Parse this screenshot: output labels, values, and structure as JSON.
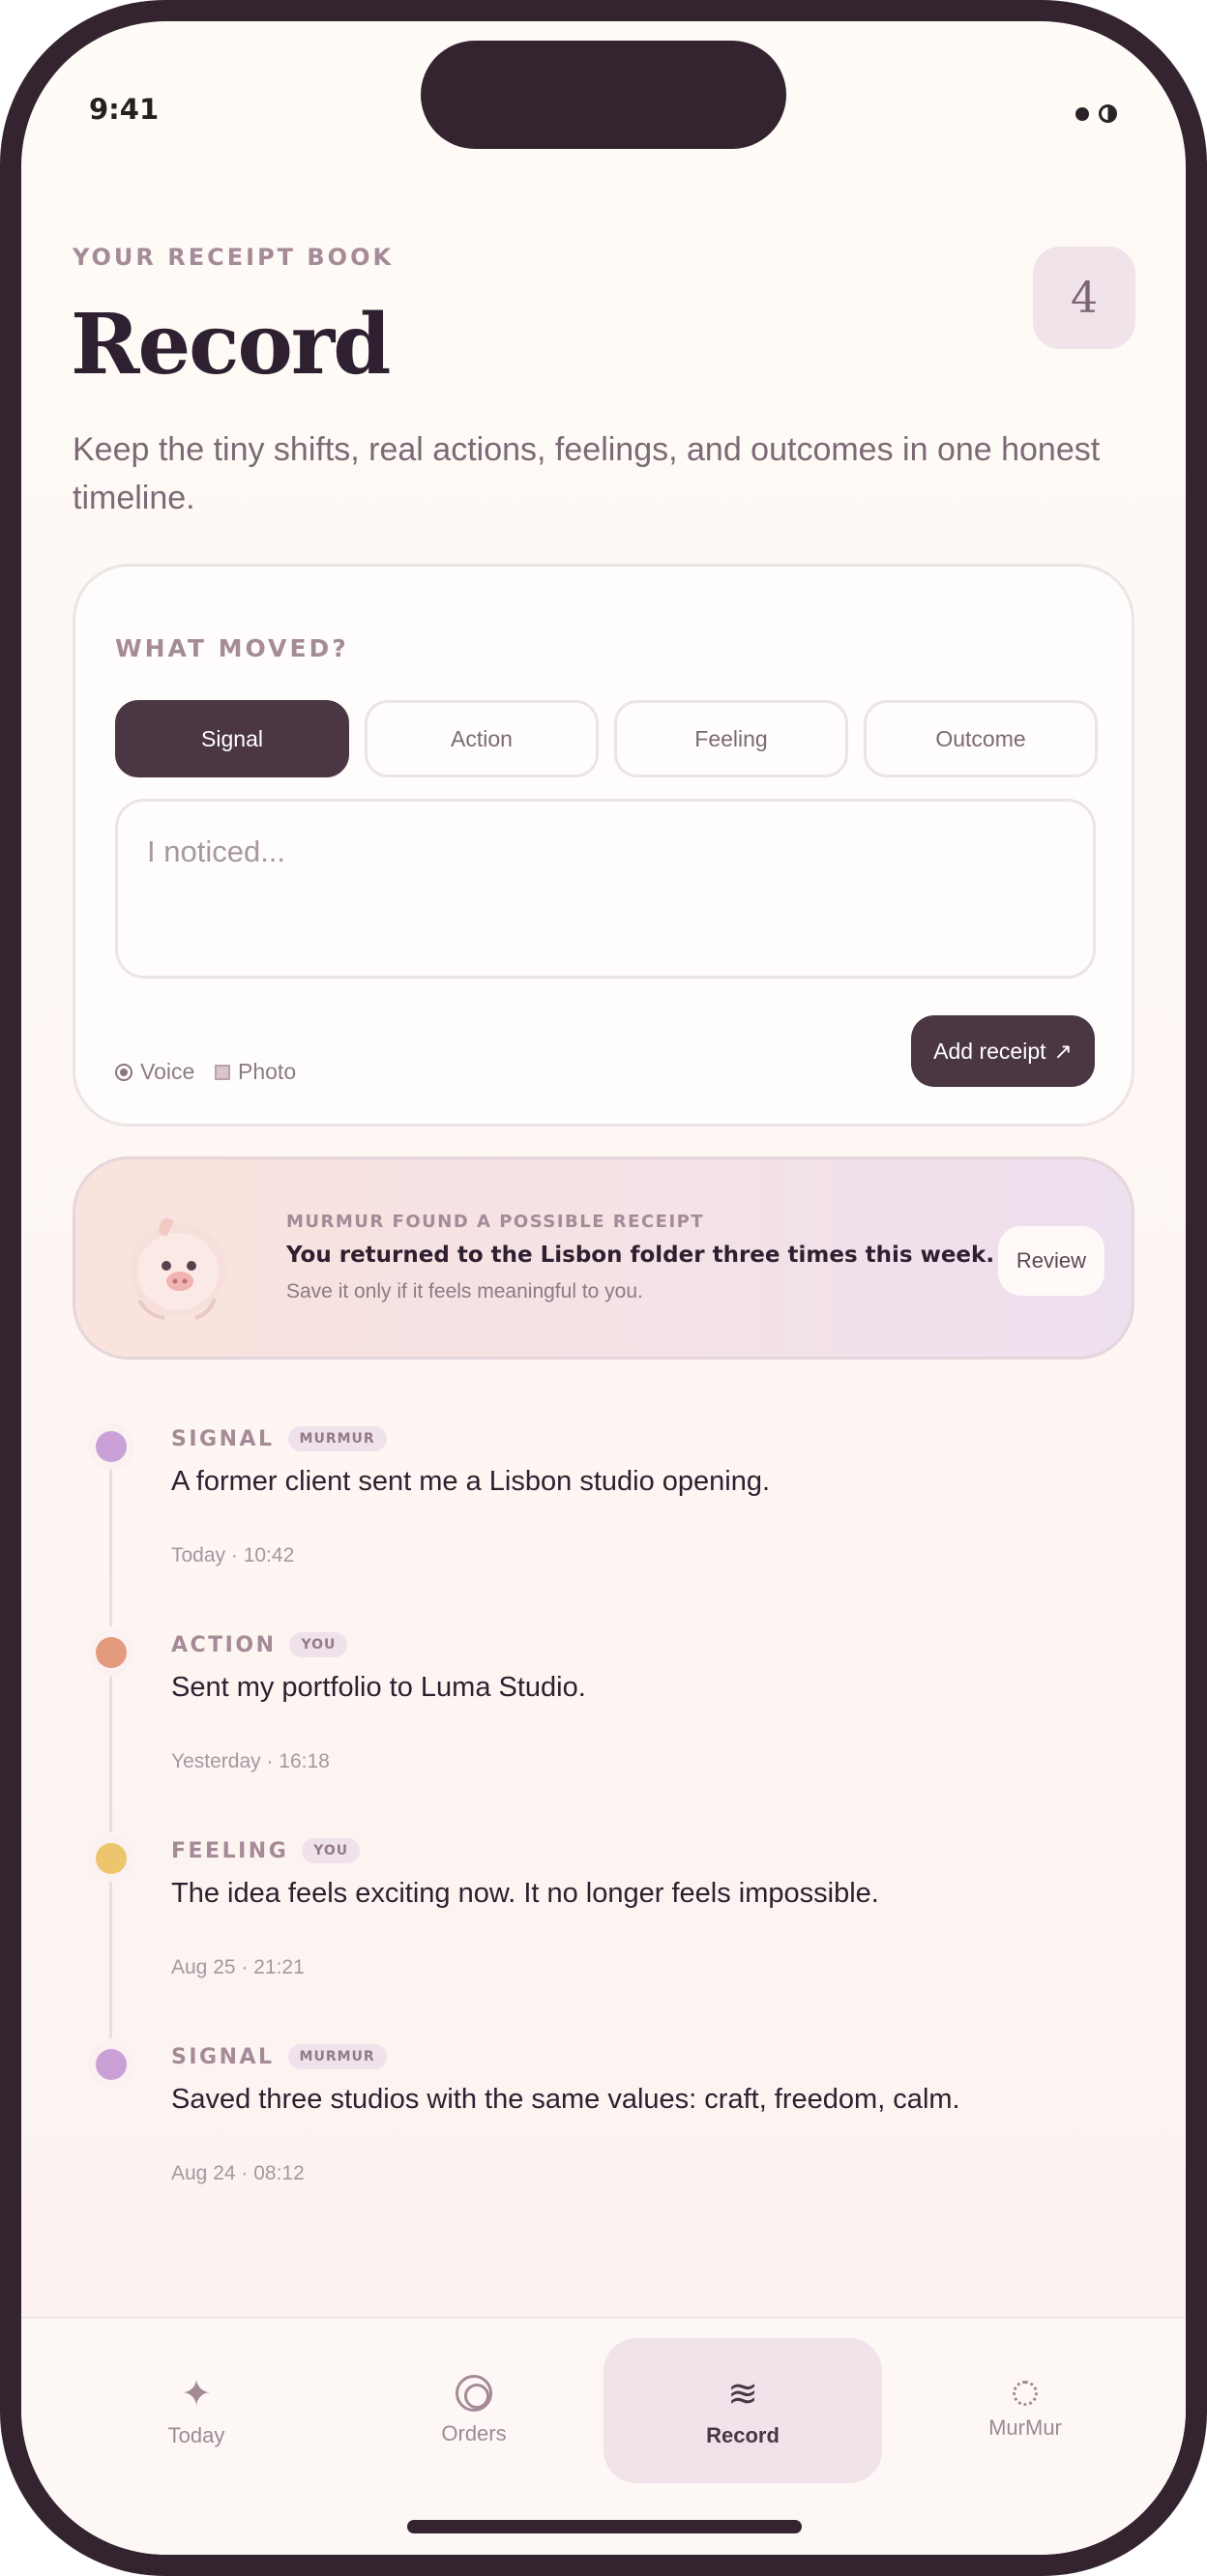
{
  "status_bar": {
    "time": "9:41",
    "icons": [
      "dot-icon",
      "half-circle-icon"
    ]
  },
  "header": {
    "eyebrow": "YOUR RECEIPT BOOK",
    "title": "Record",
    "count": "4",
    "subtitle": "Keep the tiny shifts, real actions, feelings, and outcomes in one honest timeline."
  },
  "compose": {
    "label": "WHAT MOVED?",
    "chips": [
      {
        "label": "Signal",
        "selected": true
      },
      {
        "label": "Action",
        "selected": false
      },
      {
        "label": "Feeling",
        "selected": false
      },
      {
        "label": "Outcome",
        "selected": false
      }
    ],
    "note_placeholder": "I noticed...",
    "voice_label": "Voice",
    "photo_label": "Photo",
    "add_label": "Add receipt",
    "add_icon": "↗"
  },
  "suggestion": {
    "eyebrow": "MURMUR FOUND A POSSIBLE RECEIPT",
    "title": "You returned to the Lisbon folder three times this week.",
    "subtitle": "Save it only if it feels meaningful to you.",
    "review_label": "Review",
    "mascot": "pig-mascot-image"
  },
  "timeline": [
    {
      "type": "SIGNAL",
      "source": "MURMUR",
      "text": "A former client sent me a Lisbon studio opening.",
      "time": "Today · 10:42",
      "color": "#c9a1d6"
    },
    {
      "type": "ACTION",
      "source": "YOU",
      "text": "Sent my portfolio to Luma Studio.",
      "time": "Yesterday · 16:18",
      "color": "#e39a7d"
    },
    {
      "type": "FEELING",
      "source": "YOU",
      "text": "The idea feels exciting now. It no longer feels impossible.",
      "time": "Aug 25 · 21:21",
      "color": "#ecc56c"
    },
    {
      "type": "SIGNAL",
      "source": "MURMUR",
      "text": "Saved three studios with the same values: craft, freedom, calm.",
      "time": "Aug 24 · 08:12",
      "color": "#c9a1d6"
    }
  ],
  "tabs": [
    {
      "label": "Today",
      "icon": "sparkle-icon",
      "glyph": "✦",
      "active": false
    },
    {
      "label": "Orders",
      "icon": "ring-icon",
      "glyph": "",
      "active": false
    },
    {
      "label": "Record",
      "icon": "waves-icon",
      "glyph": "≋",
      "active": true
    },
    {
      "label": "MurMur",
      "icon": "dashed-circle-icon",
      "glyph": "",
      "active": false
    }
  ],
  "colors": {
    "accent": "#4b3644",
    "muted": "#a58a97",
    "badge_bg": "#f0e3ea"
  }
}
